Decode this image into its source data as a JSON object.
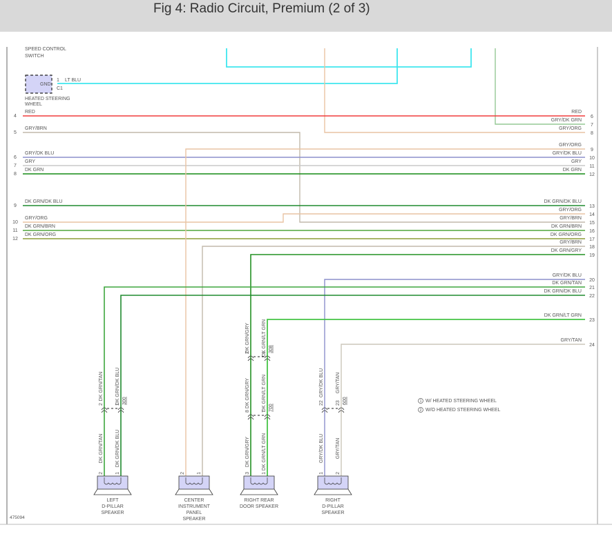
{
  "title": "Fig 4: Radio Circuit, Premium (2 of 3)",
  "figure_id": "475094",
  "top_labels": {
    "speed_control_switch": [
      "SPEED CONTROL",
      "SWITCH"
    ]
  },
  "heated_steering_wheel": {
    "label": [
      "HEATED STEERING",
      "WHEEL"
    ],
    "terminal": "GND",
    "pin": "1",
    "connector": "C1",
    "wire": "LT BLU"
  },
  "wire_colors": {
    "RED": "#f03a3a",
    "LT BLU": "#3ee6ee",
    "GRY/BRN": "#c2b9ab",
    "GRY/DK BLU": "#8c8fcc",
    "GRY": "#c9c9c9",
    "DK GRN": "#138a13",
    "DK GRN/DK BLU": "#1f8a2e",
    "GRY/ORG": "#e9c3a3",
    "DK GRN/BRN": "#4fa63a",
    "DK GRN/ORG": "#8c9c35",
    "GRY/DK GRN": "#94c894",
    "DK GRN/GRY": "#229022",
    "DK GRN/TAN": "#3da63d",
    "DK GRN/LT GRN": "#45c445",
    "GRY/TAN": "#cbc6ba"
  },
  "left_rows": [
    {
      "pin": "4",
      "label": "RED"
    },
    {
      "pin": "5",
      "label": "GRY/BRN"
    },
    {
      "pin": "6",
      "label": "GRY/DK BLU"
    },
    {
      "pin": "7",
      "label": "GRY"
    },
    {
      "pin": "8",
      "label": "DK GRN"
    },
    {
      "pin": "9",
      "label": "DK GRN/DK BLU"
    },
    {
      "pin": "10",
      "label": "GRY/ORG"
    },
    {
      "pin": "11",
      "label": "DK GRN/BRN"
    },
    {
      "pin": "12",
      "label": "DK GRN/ORG"
    }
  ],
  "right_rows": [
    {
      "pin": "6",
      "label": "RED"
    },
    {
      "pin": "7",
      "label": "GRY/DK GRN"
    },
    {
      "pin": "8",
      "label": "GRY/ORG"
    },
    {
      "pin": "9",
      "label": "GRY/ORG"
    },
    {
      "pin": "10",
      "label": "GRY/DK BLU"
    },
    {
      "pin": "11",
      "label": "GRY"
    },
    {
      "pin": "12",
      "label": "DK GRN"
    },
    {
      "pin": "13",
      "label": "DK GRN/DK BLU"
    },
    {
      "pin": "14",
      "label": "GRY/ORG"
    },
    {
      "pin": "15",
      "label": "GRY/BRN"
    },
    {
      "pin": "16",
      "label": "DK GRN/BRN"
    },
    {
      "pin": "17",
      "label": "DK GRN/ORG"
    },
    {
      "pin": "18",
      "label": "GRY/BRN"
    },
    {
      "pin": "19",
      "label": "DK GRN/GRY"
    },
    {
      "pin": "20",
      "label": "GRY/DK BLU"
    },
    {
      "pin": "21",
      "label": "DK GRN/TAN"
    },
    {
      "pin": "22",
      "label": "DK GRN/DK BLU"
    },
    {
      "pin": "23",
      "label": "DK GRN/LT GRN"
    },
    {
      "pin": "24",
      "label": "GRY/TAN"
    }
  ],
  "speakers": [
    {
      "label": [
        "LEFT",
        "D-PILLAR",
        "SPEAKER"
      ],
      "connectors": [
        "300"
      ],
      "wires": [
        {
          "label": "DK GRN/TAN",
          "connector_pins": [
            "2"
          ],
          "speaker_pin": "2"
        },
        {
          "label": "DK GRN/DK BLU",
          "connector_pins": [
            "1"
          ],
          "speaker_pin": "1"
        }
      ]
    },
    {
      "label": [
        "CENTER",
        "INSTRUMENT",
        "PANEL",
        "SPEAKER"
      ],
      "connectors": [],
      "wires": [
        {
          "label": "GRY/ORG",
          "connector_pins": [],
          "speaker_pin": "2"
        },
        {
          "label": "GRY/BRN",
          "connector_pins": [],
          "speaker_pin": "1"
        }
      ]
    },
    {
      "label": [
        "RIGHT REAR",
        "DOOR SPEAKER"
      ],
      "connectors": [
        "308",
        "700"
      ],
      "wires": [
        {
          "label": "DK GRN/GRY",
          "connector_pins": [
            "2",
            "8"
          ],
          "speaker_pin": "3"
        },
        {
          "label": "DK GRN/LT GRN",
          "connector_pins": [
            "1",
            "7"
          ],
          "speaker_pin": "1"
        }
      ]
    },
    {
      "label": [
        "RIGHT",
        "D-PILLAR",
        "SPEAKER"
      ],
      "connectors": [
        "600"
      ],
      "wires": [
        {
          "label": "GRY/DK BLU",
          "connector_pins": [
            "22"
          ],
          "speaker_pin": "1"
        },
        {
          "label": "GRY/TAN",
          "connector_pins": [
            "23"
          ],
          "speaker_pin": "2"
        }
      ]
    }
  ],
  "legend": [
    {
      "marker": "1",
      "text": "W/ HEATED STEERING WHEEL"
    },
    {
      "marker": "2",
      "text": "W/O HEATED STEERING WHEEL"
    }
  ]
}
